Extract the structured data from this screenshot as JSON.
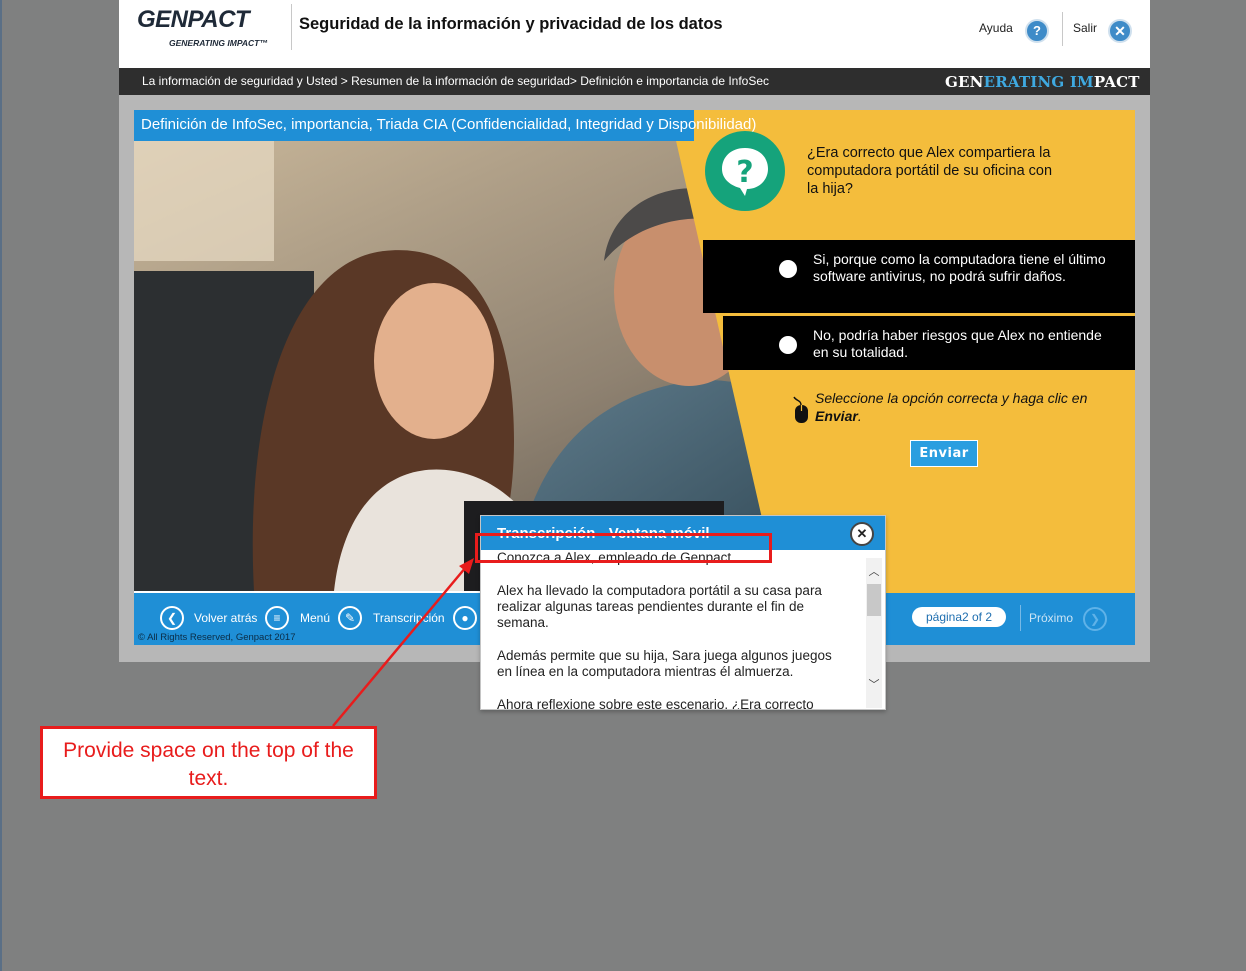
{
  "header": {
    "logo": "GENPACT",
    "logo_tagline": "GENERATING IMPACT™",
    "course_title": "Seguridad de la información y privacidad de los datos",
    "help_label": "Ayuda",
    "exit_label": "Salir"
  },
  "breadcrumb": {
    "text": "La información de seguridad y Usted > Resumen de la información de seguridad> Definición e importancia de InfoSec",
    "brand_part1": "GEN",
    "brand_part2": "ERATING ",
    "brand_part3": "IM",
    "brand_part4": "PACT"
  },
  "slide": {
    "title": "Definición de InfoSec, importancia, Triada CIA (Confidencialidad, Integridad y Disponibilidad)",
    "question": "¿Era correcto que Alex compartiera la computadora portátil de su oficina con la hija?",
    "options": [
      {
        "label": "Si, porque como la computadora tiene el último software antivirus, no podrá sufrir daños."
      },
      {
        "label": "No, podría haber riesgos que Alex no entiende en su totalidad."
      }
    ],
    "instruction_prefix": "Seleccione la opción correcta y haga clic en ",
    "instruction_bold": "Enviar",
    "instruction_suffix": ".",
    "submit_label": "Enviar",
    "colors": {
      "yellow": "#f4bd3c",
      "accent_blue": "#1f8fd6",
      "question_icon": "#15a37b"
    }
  },
  "navbar": {
    "back_label": "Volver atrás",
    "menu_label": "Menú",
    "transcript_label": "Transcripción",
    "page_indicator": "página2 of 2",
    "next_label": "Próximo",
    "copyright": "© All Rights Reserved, Genpact 2017",
    "hidden_label_tail": "n"
  },
  "popup": {
    "title": "Transcripción - Ventana móvil",
    "paragraphs": [
      "Conozca a Alex, empleado de Genpact.",
      "Alex ha llevado la computadora portátil a su casa para realizar algunas tareas pendientes durante el fin de semana.",
      "Además permite que su hija, Sara juega algunos juegos en línea en la computadora mientras él almuerza.",
      "Ahora reflexione sobre este escenario. ¿Era correcto"
    ]
  },
  "annotation": {
    "note": "Provide space on the top of the text.",
    "color": "#e81c1c"
  }
}
